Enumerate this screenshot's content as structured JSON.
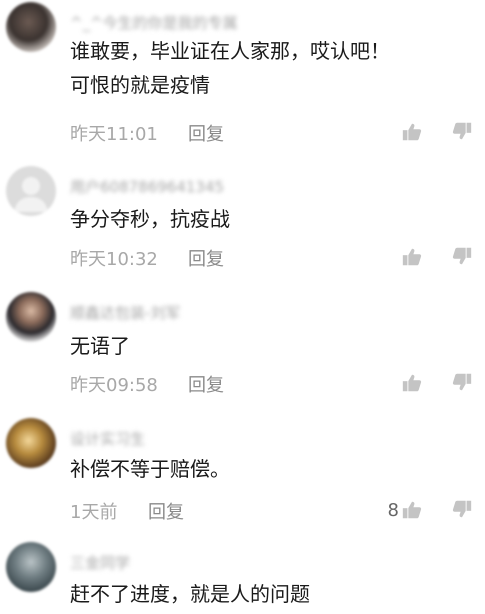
{
  "colors": {
    "meta_text": "#a8a8a8",
    "reply_text": "#8a8a8a",
    "icon": "#c4c4c4",
    "body_text": "#1a1a1a"
  },
  "comments": [
    {
      "username": "^_^今生的你是我的专属",
      "lines": [
        "谁敢要，毕业证在人家那，哎认吧！",
        "可恨的就是疫情"
      ],
      "time": "昨天11:01",
      "reply": "回复",
      "likes": "",
      "avatar": "dark-photo"
    },
    {
      "username": "用户6087869641345",
      "lines": [
        "争分夺秒，抗疫战"
      ],
      "time": "昨天10:32",
      "reply": "回复",
      "likes": "",
      "avatar": "default-gray"
    },
    {
      "username": "顺鑫达包装-刘军",
      "lines": [
        "无语了"
      ],
      "time": "昨天09:58",
      "reply": "回复",
      "likes": "",
      "avatar": "portrait-photo"
    },
    {
      "username": "设计实习生",
      "lines": [
        "补偿不等于赔偿。"
      ],
      "time": "1天前",
      "reply": "回复",
      "likes": "8",
      "avatar": "golden-photo"
    },
    {
      "username": "三金同学",
      "lines": [
        "赶不了进度，就是人的问题"
      ],
      "time": "",
      "reply": "",
      "likes": "",
      "avatar": "landscape-photo"
    }
  ]
}
